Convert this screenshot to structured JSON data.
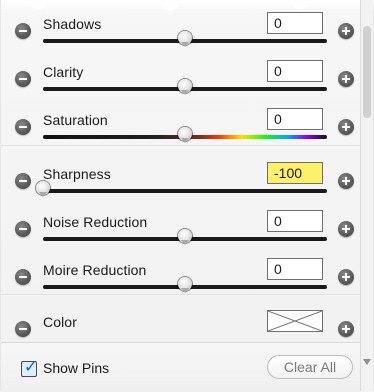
{
  "rows": [
    {
      "label": "Shadows",
      "value": "0",
      "value_highlight": false,
      "slider": {
        "type": "dark",
        "percent": 50
      }
    },
    {
      "label": "Clarity",
      "value": "0",
      "value_highlight": false,
      "slider": {
        "type": "dark",
        "percent": 50
      }
    },
    {
      "label": "Saturation",
      "value": "0",
      "value_highlight": false,
      "slider": {
        "type": "rainbow",
        "percent": 50
      }
    },
    {
      "label": "Sharpness",
      "value": "-100",
      "value_highlight": true,
      "slider": {
        "type": "dark",
        "percent": 0
      }
    },
    {
      "label": "Noise Reduction",
      "value": "0",
      "value_highlight": false,
      "slider": {
        "type": "dark",
        "percent": 50
      }
    },
    {
      "label": "Moire Reduction",
      "value": "0",
      "value_highlight": false,
      "slider": {
        "type": "dark",
        "percent": 50
      }
    }
  ],
  "color_row": {
    "label": "Color"
  },
  "footer": {
    "show_pins_label": "Show Pins",
    "show_pins_checked": true,
    "clear_all_label": "Clear All"
  }
}
